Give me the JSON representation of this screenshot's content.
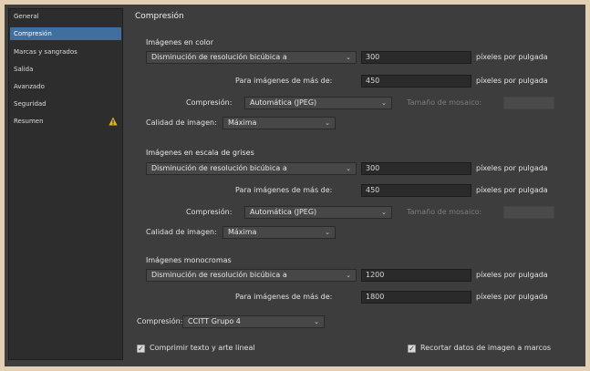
{
  "sidebar": {
    "items": [
      {
        "label": "General"
      },
      {
        "label": "Compresión"
      },
      {
        "label": "Marcas y sangrados"
      },
      {
        "label": "Salida"
      },
      {
        "label": "Avanzado"
      },
      {
        "label": "Seguridad"
      },
      {
        "label": "Resumen"
      }
    ],
    "selected": "Compresión",
    "warning_item": "Resumen",
    "selected_color": "#3f6f9f"
  },
  "panel": {
    "title": "Compresión"
  },
  "color": {
    "heading": "Imágenes en color",
    "method": "Disminución de resolución bicúbica a",
    "resolution": "300",
    "resolution_unit": "píxeles por pulgada",
    "above_label": "Para imágenes de más de:",
    "above_value": "450",
    "above_unit": "píxeles por pulgada",
    "compression_label": "Compresión:",
    "compression_value": "Automática (JPEG)",
    "tile_label": "Tamaño de mosaico:",
    "tile_value": "",
    "quality_label": "Calidad de imagen:",
    "quality_value": "Máxima"
  },
  "gray": {
    "heading": "Imágenes en escala de grises",
    "method": "Disminución de resolución bicúbica a",
    "resolution": "300",
    "resolution_unit": "píxeles por pulgada",
    "above_label": "Para imágenes de más de:",
    "above_value": "450",
    "above_unit": "píxeles por pulgada",
    "compression_label": "Compresión:",
    "compression_value": "Automática (JPEG)",
    "tile_label": "Tamaño de mosaico:",
    "tile_value": "",
    "quality_label": "Calidad de imagen:",
    "quality_value": "Máxima"
  },
  "mono": {
    "heading": "Imágenes monocromas",
    "method": "Disminución de resolución bicúbica a",
    "resolution": "1200",
    "resolution_unit": "píxeles por pulgada",
    "above_label": "Para imágenes de más de:",
    "above_value": "1800",
    "above_unit": "píxeles por pulgada",
    "compression_label": "Compresión:",
    "compression_value": "CCITT Grupo 4"
  },
  "options": {
    "compress_text_label": "Comprimir texto y arte lineal",
    "compress_text_checked": true,
    "crop_label": "Recortar datos de imagen a marcos",
    "crop_checked": true
  },
  "icons": {
    "dropdown": "chevron-down-icon",
    "warning": "warning-icon",
    "checkbox": "checkmark-icon"
  }
}
